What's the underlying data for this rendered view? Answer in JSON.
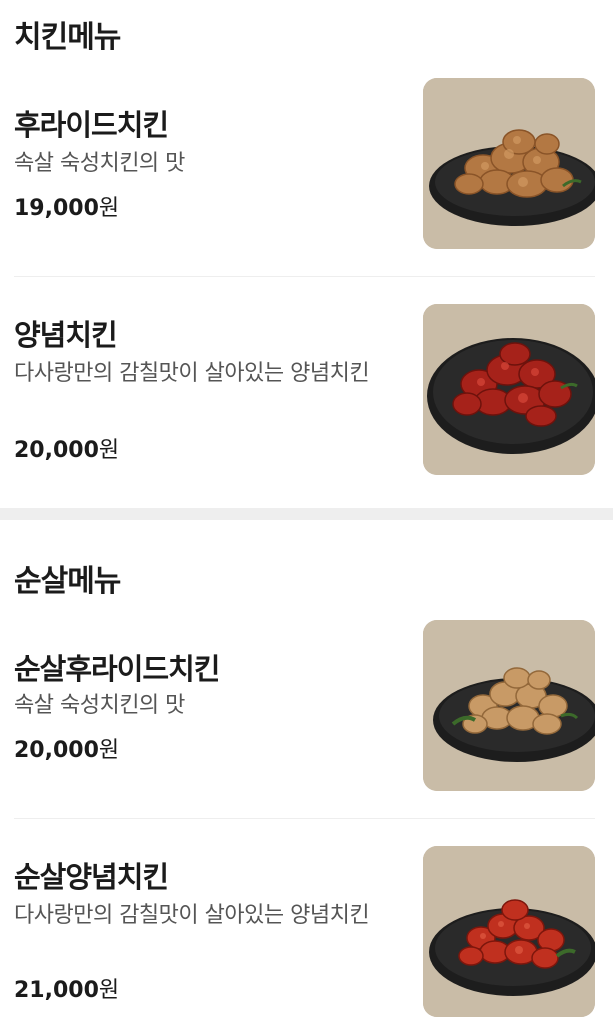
{
  "sections": [
    {
      "title": "치킨메뉴",
      "items": [
        {
          "name": "후라이드치킨",
          "desc": "속살 숙성치킨의 맛",
          "price": "19,000",
          "unit": "원",
          "image": "fried-chicken-photo"
        },
        {
          "name": "양념치킨",
          "desc": "다사랑만의 감칠맛이 살아있는 양념치킨",
          "price": "20,000",
          "unit": "원",
          "image": "seasoned-chicken-photo"
        }
      ]
    },
    {
      "title": "순살메뉴",
      "items": [
        {
          "name": "순살후라이드치킨",
          "desc": "속살 숙성치킨의 맛",
          "price": "20,000",
          "unit": "원",
          "image": "boneless-fried-chicken-photo"
        },
        {
          "name": "순살양념치킨",
          "desc": "다사랑만의 감칠맛이 살아있는 양념치킨",
          "price": "21,000",
          "unit": "원",
          "image": "boneless-seasoned-chicken-photo"
        }
      ]
    }
  ],
  "colors": {
    "text": "#1b1b1b",
    "desc": "#555555",
    "divider": "#eeeeee",
    "thumb_bg": "#c7baa5",
    "plate": "#1e1e1e",
    "fried": "#b57a45",
    "seasoned": "#a8231a"
  }
}
